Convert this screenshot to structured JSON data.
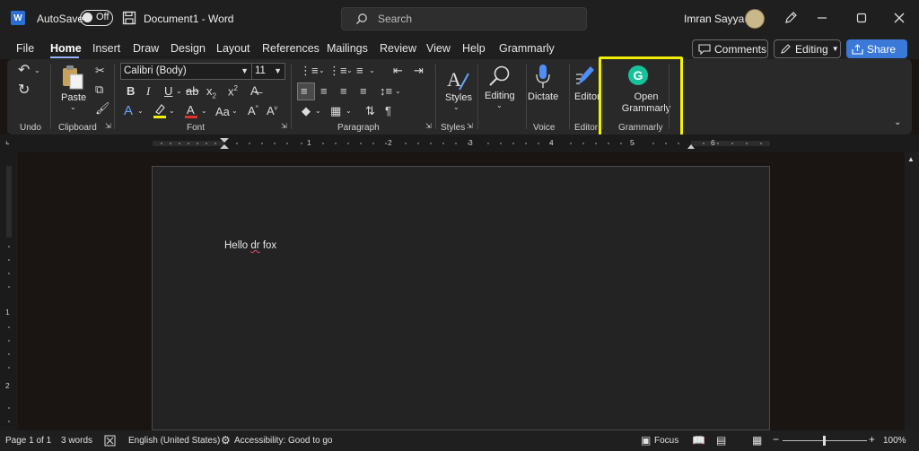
{
  "titlebar": {
    "app_logo": "W",
    "autosave_label": "AutoSave",
    "autosave_state": "Off",
    "document_title": "Document1 - Word",
    "search_placeholder": "Search",
    "user_name": "Imran Sayyad"
  },
  "tabs": {
    "items": [
      "File",
      "Home",
      "Insert",
      "Draw",
      "Design",
      "Layout",
      "References",
      "Mailings",
      "Review",
      "View",
      "Help",
      "Grammarly"
    ],
    "active": "Home",
    "comments_label": "Comments",
    "editing_label": "Editing",
    "share_label": "Share"
  },
  "ribbon": {
    "groups": {
      "undo": "Undo",
      "clipboard": "Clipboard",
      "font": "Font",
      "paragraph": "Paragraph",
      "styles": "Styles",
      "voice": "Voice",
      "editor": "Editor",
      "grammarly": "Grammarly"
    },
    "paste_label": "Paste",
    "font_name": "Calibri (Body)",
    "font_size": "11",
    "styles_label": "Styles",
    "editing_label": "Editing",
    "dictate_label": "Dictate",
    "editor_label": "Editor",
    "open_grammarly_line1": "Open",
    "open_grammarly_line2": "Grammarly",
    "grammarly_logo": "G"
  },
  "ruler": {
    "h_numbers": [
      "1",
      "2",
      "3",
      "4",
      "5",
      "6"
    ],
    "v_numbers": [
      "1",
      "2"
    ]
  },
  "document": {
    "text_word1": "Hello ",
    "text_misspelled": "dr",
    "text_word3": " fox"
  },
  "statusbar": {
    "page": "Page 1 of 1",
    "words": "3 words",
    "language": "English (United States)",
    "accessibility": "Accessibility: Good to go",
    "focus": "Focus",
    "zoom": "100%"
  },
  "colors": {
    "accent_blue": "#3b79d8",
    "grammarly_green": "#15c39a",
    "highlight_yellow": "#f0f000",
    "misspell_red": "#e0506b"
  }
}
